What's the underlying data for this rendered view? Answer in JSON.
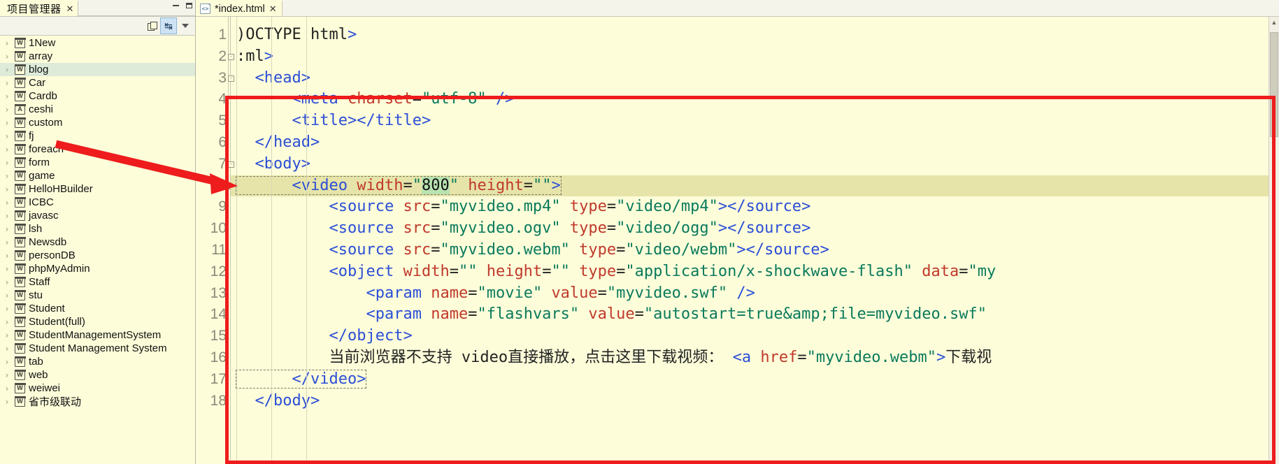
{
  "sidebar": {
    "tab": {
      "title": "项目管理器",
      "close_icon": "✕"
    },
    "window_buttons": {
      "minimize": "minimize-icon",
      "maximize": "maximize-icon"
    },
    "toolbar": {
      "collapse_all_label": "copy-icon",
      "link_with_editor_label": "↹",
      "view_menu_label": "chevron-down-icon"
    },
    "items": [
      {
        "label": "1New",
        "icon": "W",
        "expander": "›",
        "selected": false
      },
      {
        "label": "array",
        "icon": "W",
        "expander": "›",
        "selected": false
      },
      {
        "label": "blog",
        "icon": "W",
        "expander": "›",
        "selected": true
      },
      {
        "label": "Car",
        "icon": "W",
        "expander": "›",
        "selected": false
      },
      {
        "label": "Cardb",
        "icon": "W",
        "expander": "›",
        "selected": false
      },
      {
        "label": "ceshi",
        "icon": "A",
        "expander": "›",
        "selected": false
      },
      {
        "label": "custom",
        "icon": "W",
        "expander": "›",
        "selected": false
      },
      {
        "label": "fj",
        "icon": "W",
        "expander": "›",
        "selected": false
      },
      {
        "label": "foreach",
        "icon": "W",
        "expander": "›",
        "selected": false
      },
      {
        "label": "form",
        "icon": "W",
        "expander": "›",
        "selected": false
      },
      {
        "label": "game",
        "icon": "W",
        "expander": "›",
        "selected": false
      },
      {
        "label": "HelloHBuilder",
        "icon": "W",
        "expander": "›",
        "selected": false
      },
      {
        "label": "ICBC",
        "icon": "W",
        "expander": "›",
        "selected": false
      },
      {
        "label": "javasc",
        "icon": "W",
        "expander": "›",
        "selected": false
      },
      {
        "label": "lsh",
        "icon": "W",
        "expander": "›",
        "selected": false
      },
      {
        "label": "Newsdb",
        "icon": "W",
        "expander": "›",
        "selected": false
      },
      {
        "label": "personDB",
        "icon": "W",
        "expander": "›",
        "selected": false
      },
      {
        "label": "phpMyAdmin",
        "icon": "W",
        "expander": "›",
        "selected": false
      },
      {
        "label": "Staff",
        "icon": "W",
        "expander": "›",
        "selected": false
      },
      {
        "label": "stu",
        "icon": "W",
        "expander": "›",
        "selected": false
      },
      {
        "label": "Student",
        "icon": "W",
        "expander": "›",
        "selected": false
      },
      {
        "label": "Student(full)",
        "icon": "W",
        "expander": "›",
        "selected": false
      },
      {
        "label": "StudentManagementSystem",
        "icon": "W",
        "expander": "›",
        "selected": false
      },
      {
        "label": "Student Management System",
        "icon": "W",
        "expander": "›",
        "selected": false
      },
      {
        "label": "tab",
        "icon": "W",
        "expander": "›",
        "selected": false
      },
      {
        "label": "web",
        "icon": "W",
        "expander": "›",
        "selected": false
      },
      {
        "label": "weiwei",
        "icon": "W",
        "expander": "›",
        "selected": false
      },
      {
        "label": "省市级联动",
        "icon": "W",
        "expander": "›",
        "selected": false
      }
    ]
  },
  "editor": {
    "tab": {
      "title": "*index.html",
      "close_icon": "✕",
      "file_icon": "html-file-icon"
    },
    "gutter_numbers": [
      "1",
      "2",
      "3",
      "4",
      "5",
      "6",
      "7",
      "8",
      "9",
      "10",
      "11",
      "12",
      "13",
      "14",
      "15",
      "16",
      "17",
      "18"
    ],
    "current_line": 8,
    "selected_text": "800",
    "lines": [
      {
        "n": "1",
        "text": ")OCTYPE html>"
      },
      {
        "n": "2",
        "text": ":ml>"
      },
      {
        "n": "3",
        "text": "  <head>"
      },
      {
        "n": "4",
        "text": "      <meta charset=\"utf-8\" />"
      },
      {
        "n": "5",
        "text": "      <title></title>"
      },
      {
        "n": "6",
        "text": "  </head>"
      },
      {
        "n": "7",
        "text": "  <body>"
      },
      {
        "n": "8",
        "text": "      <video width=\"800\" height=\"\">"
      },
      {
        "n": "9",
        "text": "          <source src=\"myvideo.mp4\" type=\"video/mp4\"></source>"
      },
      {
        "n": "10",
        "text": "          <source src=\"myvideo.ogv\" type=\"video/ogg\"></source>"
      },
      {
        "n": "11",
        "text": "          <source src=\"myvideo.webm\" type=\"video/webm\"></source>"
      },
      {
        "n": "12",
        "text": "          <object width=\"\" height=\"\" type=\"application/x-shockwave-flash\" data=\"my"
      },
      {
        "n": "13",
        "text": "              <param name=\"movie\" value=\"myvideo.swf\" />"
      },
      {
        "n": "14",
        "text": "              <param name=\"flashvars\" value=\"autostart=true&amp;file=myvideo.swf\""
      },
      {
        "n": "15",
        "text": "          </object>"
      },
      {
        "n": "16",
        "text": "          当前浏览器不支持 video直接播放，点击这里下载视频： <a href=\"myvideo.webm\">下载视"
      },
      {
        "n": "17",
        "text": "      </video>"
      },
      {
        "n": "18",
        "text": "  </body>"
      }
    ]
  },
  "annotation": {
    "rect_color": "#ee1c1c",
    "arrow_color": "#ee1c1c",
    "arrow_from": "foreach",
    "arrow_to_line": "8"
  }
}
